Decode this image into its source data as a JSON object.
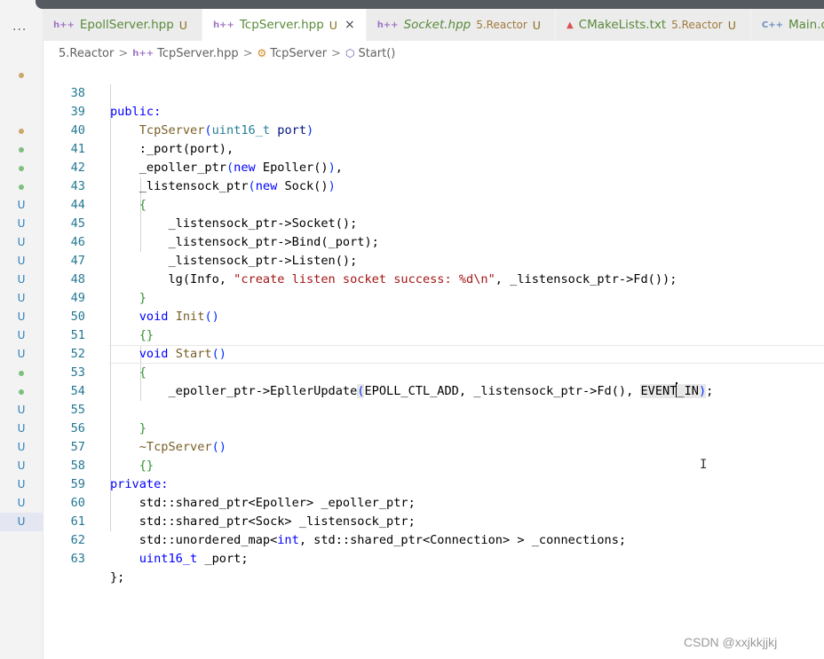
{
  "tabs": [
    {
      "icon": "h++",
      "name": "EpollServer.hpp",
      "dir": "",
      "status": "U",
      "active": false
    },
    {
      "icon": "h++",
      "name": "TcpServer.hpp",
      "dir": "",
      "status": "U",
      "active": true,
      "close": "×"
    },
    {
      "icon": "h++",
      "name": "Socket.hpp",
      "dir": "5.Reactor",
      "status": "U",
      "active": false
    },
    {
      "icon": "▲",
      "name": "CMakeLists.txt",
      "dir": "5.Reactor",
      "status": "U",
      "active": false
    },
    {
      "icon": "C++",
      "name": "Main.cc",
      "dir": "",
      "status": "",
      "active": false
    }
  ],
  "more_dots": "···",
  "breadcrumb": {
    "folder": "5.Reactor",
    "file_icon": "h++",
    "file": "TcpServer.hpp",
    "class_icon": "⚙",
    "class": "TcpServer",
    "method_icon": "⬡",
    "method": "Start()",
    "sep": ">"
  },
  "gutter": [
    "dot-brown",
    "",
    "dot-brown",
    "dot-green",
    "dot-green",
    "dot-green",
    "U",
    "U",
    "U",
    "U",
    "U",
    "U",
    "U",
    "U",
    "U",
    "dot-green",
    "dot-green",
    "U",
    "U",
    "U",
    "U",
    "U",
    "U",
    "U"
  ],
  "lines": [
    {
      "n": "38"
    },
    {
      "n": "39"
    },
    {
      "n": "40"
    },
    {
      "n": "41"
    },
    {
      "n": "42"
    },
    {
      "n": "43"
    },
    {
      "n": "44"
    },
    {
      "n": "45"
    },
    {
      "n": "46"
    },
    {
      "n": "47"
    },
    {
      "n": "48"
    },
    {
      "n": "49"
    },
    {
      "n": "50"
    },
    {
      "n": "51"
    },
    {
      "n": "52"
    },
    {
      "n": "53"
    },
    {
      "n": "54"
    },
    {
      "n": "55"
    },
    {
      "n": "56"
    },
    {
      "n": "57"
    },
    {
      "n": "58"
    },
    {
      "n": "59"
    },
    {
      "n": "60"
    },
    {
      "n": "61"
    },
    {
      "n": "62"
    },
    {
      "n": "63"
    }
  ],
  "code": {
    "l38": "public:",
    "l39a": "TcpServer",
    "l39b": "uint16_t",
    "l39c": " port",
    "l40": ":_port(port),",
    "l41a": "_epoller_ptr",
    "l41b": "new",
    "l41c": " Epoller()",
    "l42a": "_listensock_ptr",
    "l42b": "new",
    "l42c": " Sock()",
    "l44": "_listensock_ptr->Socket();",
    "l45": "_listensock_ptr->Bind(_port);",
    "l46": "_listensock_ptr->Listen();",
    "l47a": "lg(Info, ",
    "l47b": "\"create listen socket success: %d\\n\"",
    "l47c": ", _listensock_ptr->Fd());",
    "l49a": "void",
    "l49b": "Init",
    "l51a": "void",
    "l51b": "Start",
    "l53a": "_epoller_ptr->EpllerUpdate",
    "l53b": "EPOLL_CTL_ADD, _listensock_ptr->Fd(), ",
    "l53c": "EVENT",
    "l53d": "_IN",
    "l56": "~TcpServer",
    "l58": "private:",
    "l59": "std::shared_ptr<Epoller> _epoller_ptr;",
    "l60": "std::shared_ptr<Sock> _listensock_ptr;",
    "l61a": "std::unordered_map<",
    "l61b": "int",
    "l61c": ", std::shared_ptr<Connection> > _connections;",
    "l62a": "uint16_t",
    "l62b": " _port;",
    "l63": "};"
  },
  "watermark": "CSDN @xxjkkjjkj"
}
